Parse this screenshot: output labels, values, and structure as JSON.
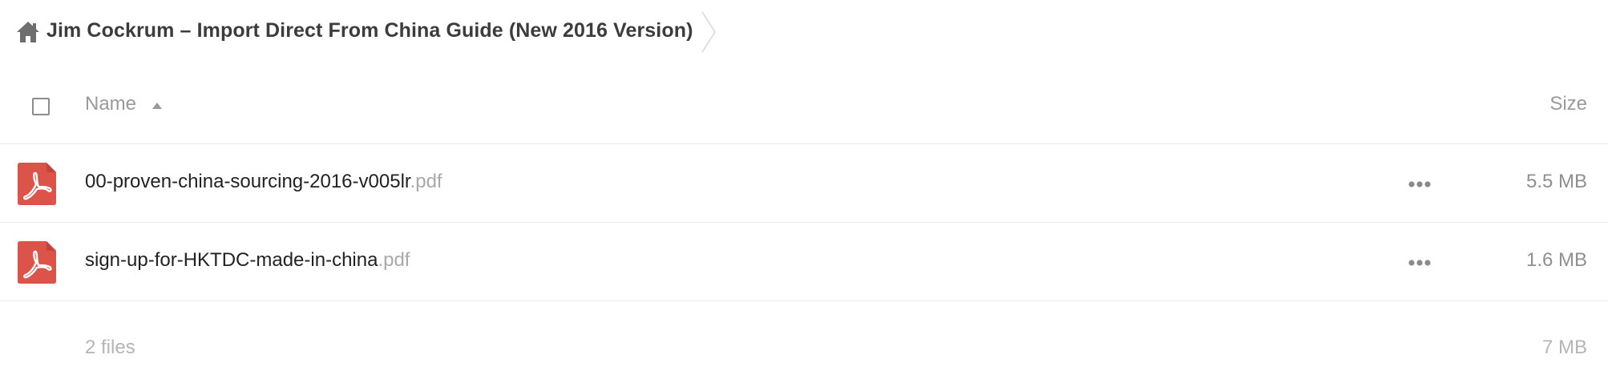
{
  "breadcrumb": {
    "home_icon": "home-icon",
    "title": "Jim Cockrum – Import Direct From China Guide (New 2016 Version)",
    "separator_icon": "chevron-right-icon"
  },
  "file_list": {
    "header": {
      "name_label": "Name",
      "sort": "ascending",
      "size_label": "Size"
    },
    "files": [
      {
        "basename": "00-proven-china-sourcing-2016-v005lr",
        "extension": ".pdf",
        "icon": "pdf-icon",
        "size": "5.5 MB"
      },
      {
        "basename": "sign-up-for-HKTDC-made-in-china",
        "extension": ".pdf",
        "icon": "pdf-icon",
        "size": "1.6 MB"
      }
    ],
    "summary": {
      "file_count": "2 files",
      "total_size": "7 MB"
    }
  },
  "colors": {
    "pdf_red": "#dc5349",
    "icon_gray": "#6e6e6e",
    "row_border": "#ececec"
  }
}
